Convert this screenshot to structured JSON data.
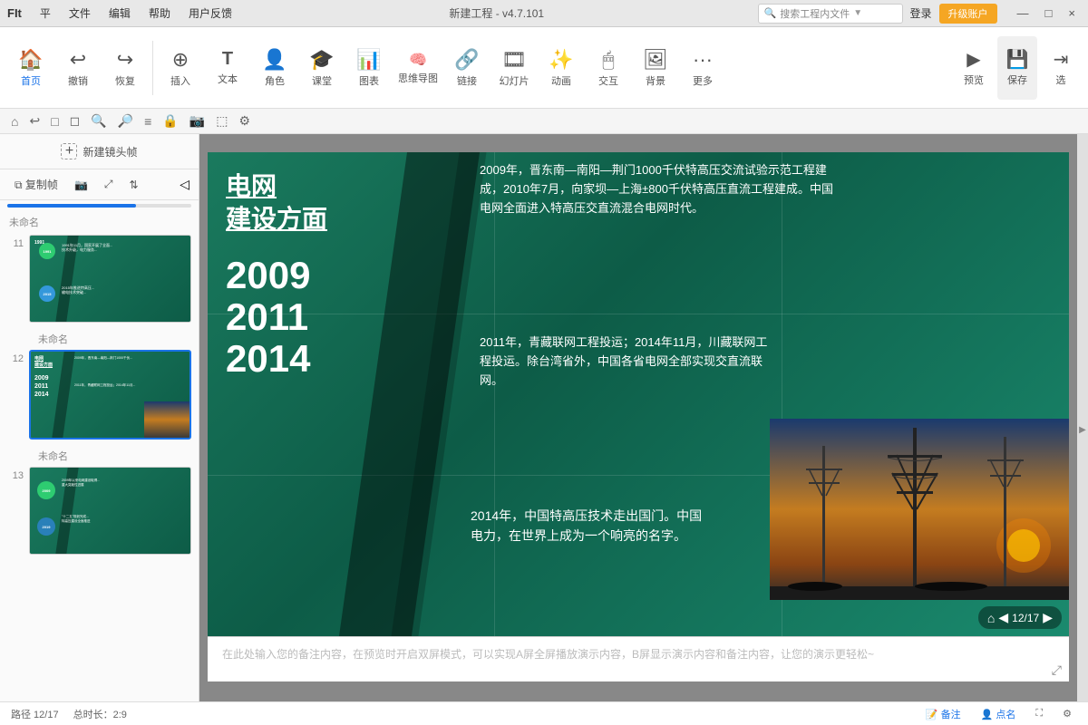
{
  "titlebar": {
    "logo": "FIt",
    "menus": [
      "平",
      "文件",
      "编辑",
      "帮助",
      "用户反馈"
    ],
    "title": "新建工程 - v4.7.101",
    "search_placeholder": "搜索工程内文件",
    "login_label": "登录",
    "upgrade_label": "升级账户",
    "win_controls": [
      "—",
      "□",
      "×"
    ]
  },
  "toolbar": {
    "items": [
      {
        "icon": "🏠",
        "label": "首页"
      },
      {
        "icon": "↩",
        "label": "撤销"
      },
      {
        "icon": "↪",
        "label": "恢复"
      },
      {
        "icon": "＋",
        "label": "插入"
      },
      {
        "icon": "T",
        "label": "文本"
      },
      {
        "icon": "👤",
        "label": "角色"
      },
      {
        "icon": "🎓",
        "label": "课堂"
      },
      {
        "icon": "📊",
        "label": "图表"
      },
      {
        "icon": "🧠",
        "label": "思维导图"
      },
      {
        "icon": "🔗",
        "label": "链接"
      },
      {
        "icon": "🎞",
        "label": "幻灯片"
      },
      {
        "icon": "🎬",
        "label": "动画"
      },
      {
        "icon": "🖱",
        "label": "交互"
      },
      {
        "icon": "🖼",
        "label": "背景"
      },
      {
        "icon": "⋯",
        "label": "更多"
      }
    ],
    "right_items": [
      {
        "icon": "👁",
        "label": "预览"
      },
      {
        "icon": "💾",
        "label": "保存"
      },
      {
        "icon": "⇥",
        "label": "选"
      }
    ]
  },
  "viewbar": {
    "icons": [
      "🏠",
      "↰",
      "□",
      "□",
      "🔍+",
      "🔍-",
      "≡",
      "🔒",
      "📷",
      "⬚",
      "⚙"
    ]
  },
  "left_panel": {
    "new_frame_label": "新建镜头帧",
    "copy_label": "复制帧",
    "screenshot_label": "",
    "unnamed_label": "未命名",
    "slides": [
      {
        "num": "11",
        "name": "未命名",
        "active": false
      },
      {
        "num": "12",
        "name": "未命名",
        "active": true
      },
      {
        "num": "13",
        "name": "",
        "active": false
      }
    ]
  },
  "slide": {
    "title_line1": "电网",
    "title_line2": "建设方面",
    "years": [
      "2009",
      "2011",
      "2014"
    ],
    "text_block1": "2009年，晋东南—南阳—荆门1000千伏特高压交流试验示范工程建成，2010年7月，向家坝—上海±800千伏特高压直流工程建成。中国电网全面进入特高压交直流混合电网时代。",
    "text_block2": "2011年，青藏联网工程投运；2014年11月，川藏联网工程投运。除台湾省外，中国各省电网全部实现交直流联网。",
    "text_block3": "2014年，中国特高压技术走出国门。中国电力，在世界上成为一个响亮的名字。",
    "page_current": "12",
    "page_total": "17"
  },
  "notes": {
    "placeholder": "在此处输入您的备注内容，在预览时开启双屏模式，可以实现A屏全屏播放演示内容，B屏显示演示内容和备注内容，让您的演示更轻松~"
  },
  "statusbar": {
    "path": "路径 12/17",
    "duration": "总时长：2:9",
    "notes_btn": "备注",
    "callout_btn": "点名"
  }
}
